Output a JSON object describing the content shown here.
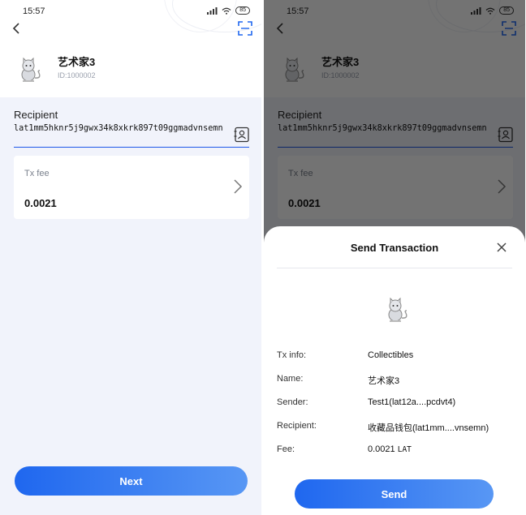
{
  "status_bar": {
    "time": "15:57",
    "battery": "85"
  },
  "nft": {
    "name": "艺术家3",
    "id": "ID:1000002"
  },
  "form": {
    "recipient_label": "Recipient",
    "recipient_address": "lat1mm5hknr5j9gwx34k8xkrk897t09ggmadvnsemn",
    "fee_label": "Tx fee",
    "fee_value": "0.0021",
    "next_label": "Next"
  },
  "dialog": {
    "title": "Send Transaction",
    "rows": [
      {
        "label": "Tx info:",
        "value": "Collectibles"
      },
      {
        "label": "Name:",
        "value": "艺术家3"
      },
      {
        "label": "Sender:",
        "value": "Test1(lat12a....pcdvt4)"
      },
      {
        "label": "Recipient:",
        "value": "收藏品钱包(lat1mm....vnsemn)"
      },
      {
        "label": "Fee:",
        "value": "0.0021",
        "unit": "LAT"
      }
    ],
    "send_label": "Send"
  },
  "colors": {
    "accent": "#1f67ef",
    "accent_light": "#5897f4",
    "background": "#f1f3fb"
  }
}
